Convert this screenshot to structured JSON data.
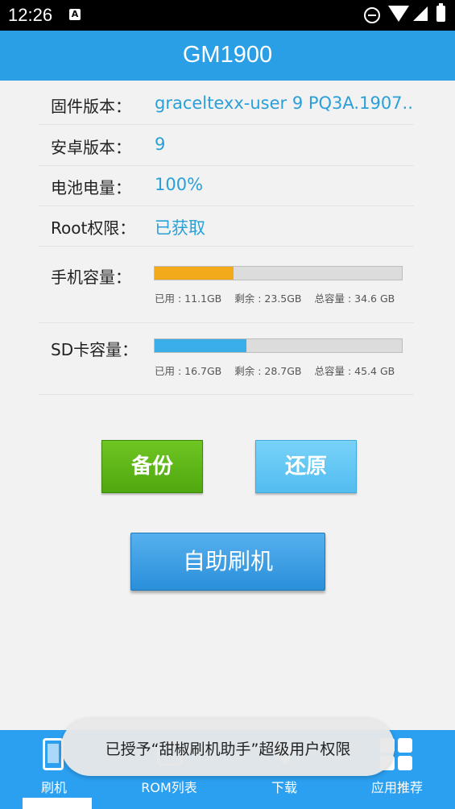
{
  "status_bar": {
    "time": "12:26",
    "notification_icon": "A"
  },
  "title_bar": {
    "title": "GM1900"
  },
  "info": {
    "firmware_label": "固件版本：",
    "firmware_value": "graceltexx-user 9 PQ3A.1907..",
    "android_label": "安卓版本：",
    "android_value": "9",
    "battery_label": "电池电量：",
    "battery_value": "100%",
    "root_label": "Root权限：",
    "root_value": "已获取"
  },
  "phone_storage": {
    "label": "手机容量：",
    "used": "已用 : 11.1GB",
    "free": "剩余 : 23.5GB",
    "total": "总容量 : 34.6 GB",
    "fill_fraction": 0.32,
    "fill_color": "#f2a91a"
  },
  "sd_storage": {
    "label": "SD卡容量：",
    "used": "已用 : 16.7GB",
    "free": "剩余 : 28.7GB",
    "total": "总容量 : 45.4 GB",
    "fill_fraction": 0.37,
    "fill_color": "#3aaee8"
  },
  "buttons": {
    "backup": "备份",
    "restore": "还原",
    "flash": "自助刷机"
  },
  "bottom_nav": {
    "items": [
      {
        "label": "刷机",
        "icon": "phone-icon"
      },
      {
        "label": "ROM列表",
        "icon": "rom-icon"
      },
      {
        "label": "下载",
        "icon": "download-icon"
      },
      {
        "label": "应用推荐",
        "icon": "apps-grid-icon"
      }
    ]
  },
  "toast": {
    "text": "已授予“甜椒刷机助手”超级用户权限"
  }
}
